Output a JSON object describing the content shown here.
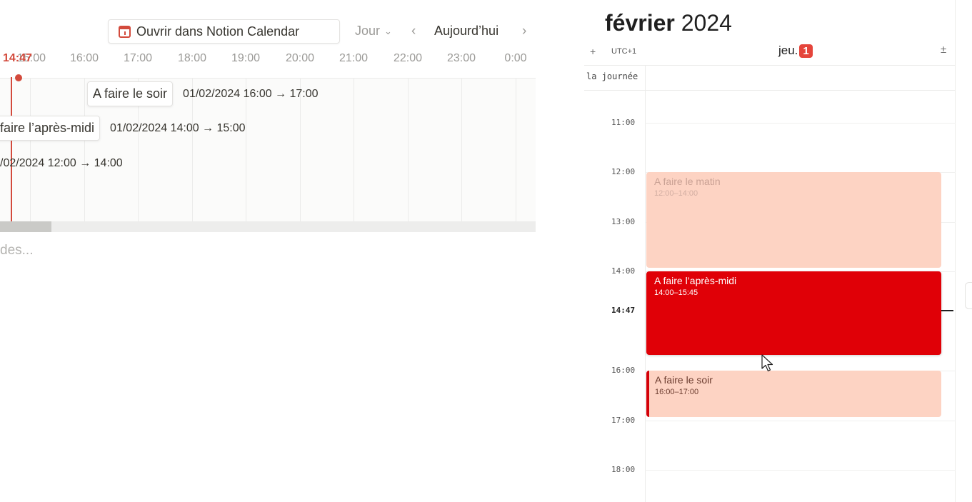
{
  "timeline": {
    "open_button_label": "Ouvrir dans Notion Calendar",
    "view_select": "Jour",
    "today_label": "Aujourd’hui",
    "now_label": "14:47",
    "hours": [
      "15:00",
      "16:00",
      "17:00",
      "18:00",
      "19:00",
      "20:00",
      "21:00",
      "22:00",
      "23:00",
      "0:00"
    ],
    "items": [
      {
        "title": "A faire le soir",
        "date": "01/02/2024 16:00 → 17:00"
      },
      {
        "title": "faire l’après-midi",
        "date": "01/02/2024 14:00 → 15:00"
      },
      {
        "title": "",
        "date": "/02/2024 12:00 → 14:00"
      }
    ],
    "placeholder": "des..."
  },
  "calendar": {
    "month": "février",
    "year": "2024",
    "timezone": "UTC+1",
    "day_name": "jeu.",
    "day_number": "1",
    "all_day_label": "la journée",
    "hour_labels": [
      "11:00",
      "12:00",
      "13:00",
      "14:00",
      "16:00",
      "17:00",
      "18:00"
    ],
    "now_label": "14:47",
    "events": [
      {
        "title": "A faire le matin",
        "time": "12:00–14:00"
      },
      {
        "title": "A faire l’après-midi",
        "time": "14:00–15:45"
      },
      {
        "title": "A faire le soir",
        "time": "16:00–17:00"
      }
    ],
    "colors": {
      "accent": "#e00007",
      "event_light": "#fdd3c3",
      "badge": "#e5453b",
      "now_line": "#d34a3c"
    }
  }
}
